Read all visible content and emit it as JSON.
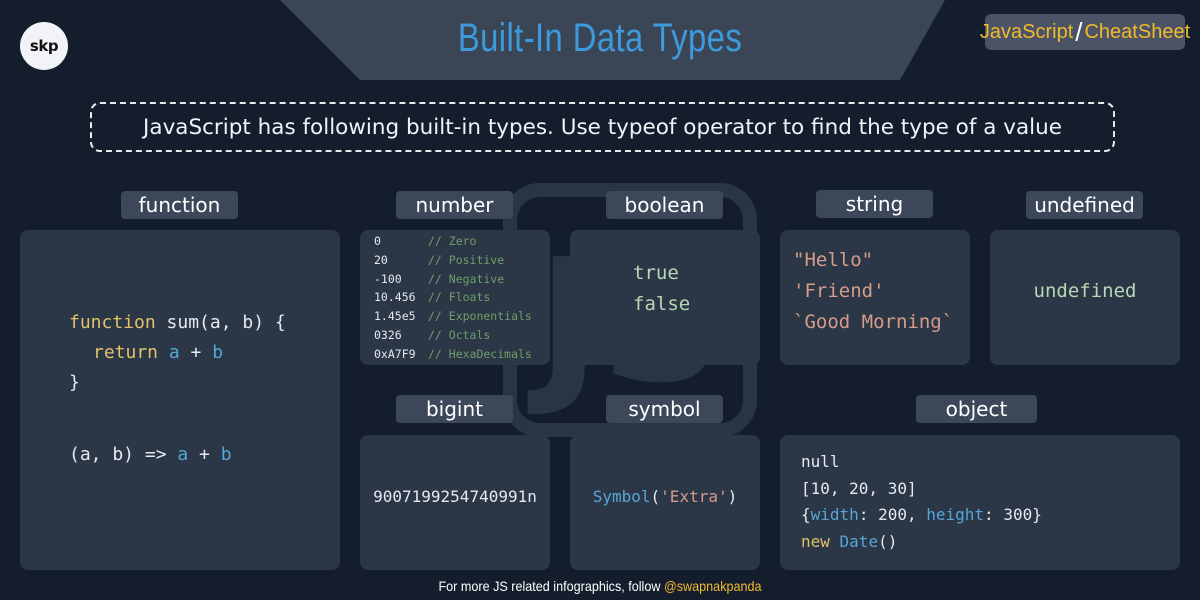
{
  "header": {
    "logo_text": "skp",
    "title": "Built-In Data Types",
    "badge_left": "JavaScript",
    "badge_sep": "/",
    "badge_right": "CheatSheet"
  },
  "intro": "JavaScript has following built-in types. Use typeof operator to find the type of a value",
  "labels": {
    "function": "function",
    "number": "number",
    "boolean": "boolean",
    "string": "string",
    "undefined": "undefined",
    "bigint": "bigint",
    "symbol": "symbol",
    "object": "object"
  },
  "function_card": {
    "l1_kw": "function",
    "l1_rest": " sum(a, b) {",
    "l2_kw": "return",
    "l2_a": "a",
    "l2_op": " + ",
    "l2_b": "b",
    "l3": "}",
    "l4_args": "(a, b) => ",
    "l4_a": "a",
    "l4_op": " + ",
    "l4_b": "b"
  },
  "number_rows": [
    {
      "value": "0",
      "comment": "// Zero"
    },
    {
      "value": "20",
      "comment": "// Positive"
    },
    {
      "value": "-100",
      "comment": "// Negative"
    },
    {
      "value": "10.456",
      "comment": "// Floats"
    },
    {
      "value": "1.45e5",
      "comment": "// Exponentials"
    },
    {
      "value": "0326",
      "comment": "// Octals"
    },
    {
      "value": "0xA7F9",
      "comment": "// HexaDecimals"
    }
  ],
  "boolean_card": {
    "v1": "true",
    "v2": "false"
  },
  "string_card": {
    "v1": "\"Hello\"",
    "v2": "'Friend'",
    "v3": "`Good Morning`"
  },
  "undefined_card": {
    "v1": "undefined"
  },
  "bigint_card": {
    "v1": "9007199254740991n"
  },
  "symbol_card": {
    "fn": "Symbol",
    "open": "(",
    "arg": "'Extra'",
    "close": ")"
  },
  "object_card": {
    "l1": "null",
    "l2": "[10, 20, 30]",
    "l3_open": "{",
    "l3_k1": "width",
    "l3_v1": ": 200, ",
    "l3_k2": "height",
    "l3_v2": ": 300}",
    "l4_kw": "new",
    "l4_fn": " Date",
    "l4_rest": "()"
  },
  "footer": {
    "text": "For more JS related infographics, follow ",
    "handle": "@swapnakpanda"
  },
  "watermark_text": "JS",
  "colors": {
    "background": "#131d2c",
    "card": "#2b3646",
    "label_bg": "#3c4759",
    "title": "#3d9bdc",
    "accent": "#f1b92c",
    "keyword": "#e2c36a",
    "identifier": "#57a6d8",
    "string": "#d49c8a",
    "comment": "#6f9f6a"
  }
}
